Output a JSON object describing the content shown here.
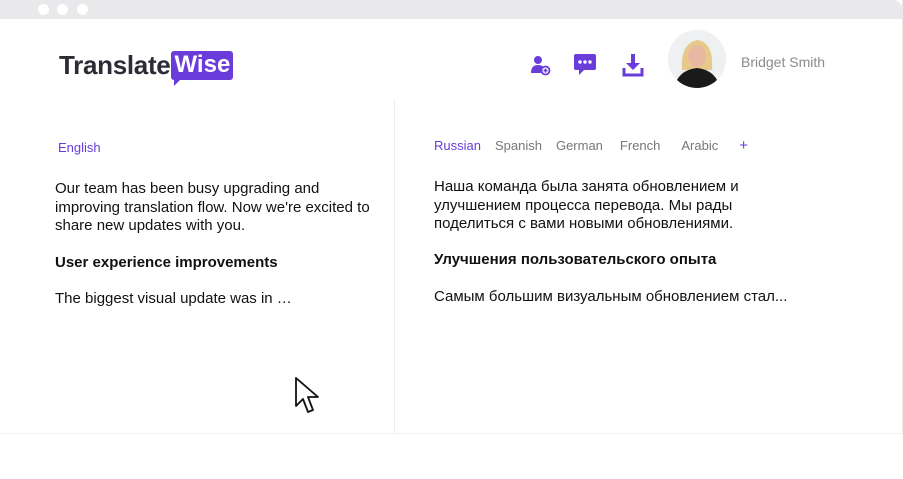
{
  "app": {
    "logo_part1": "Translate",
    "logo_part2": "Wise"
  },
  "header": {
    "icons": [
      "add-user-icon",
      "chat-icon",
      "download-icon"
    ],
    "user_name": "Bridget Smith"
  },
  "source": {
    "language": "English",
    "paragraph1": "Our team has been busy upgrading and improving translation flow. Now we're excited to share new updates with you.",
    "heading": "User experience improvements",
    "paragraph2": "The biggest visual update was in …"
  },
  "target": {
    "tabs": [
      "Russian",
      "Spanish",
      "German",
      "French",
      "Arabic"
    ],
    "active_tab": "Russian",
    "add_label": "+",
    "paragraph1": "Наша команда была занята обновлением и улучшением процесса перевода. Мы рады поделиться с вами новыми обновлениями.",
    "heading": "Улучшения пользовательского опыта",
    "paragraph2": "Самым большим визуальным обновлением стал..."
  },
  "colors": {
    "accent": "#6a3ddb",
    "text": "#111111",
    "muted": "#777777"
  }
}
